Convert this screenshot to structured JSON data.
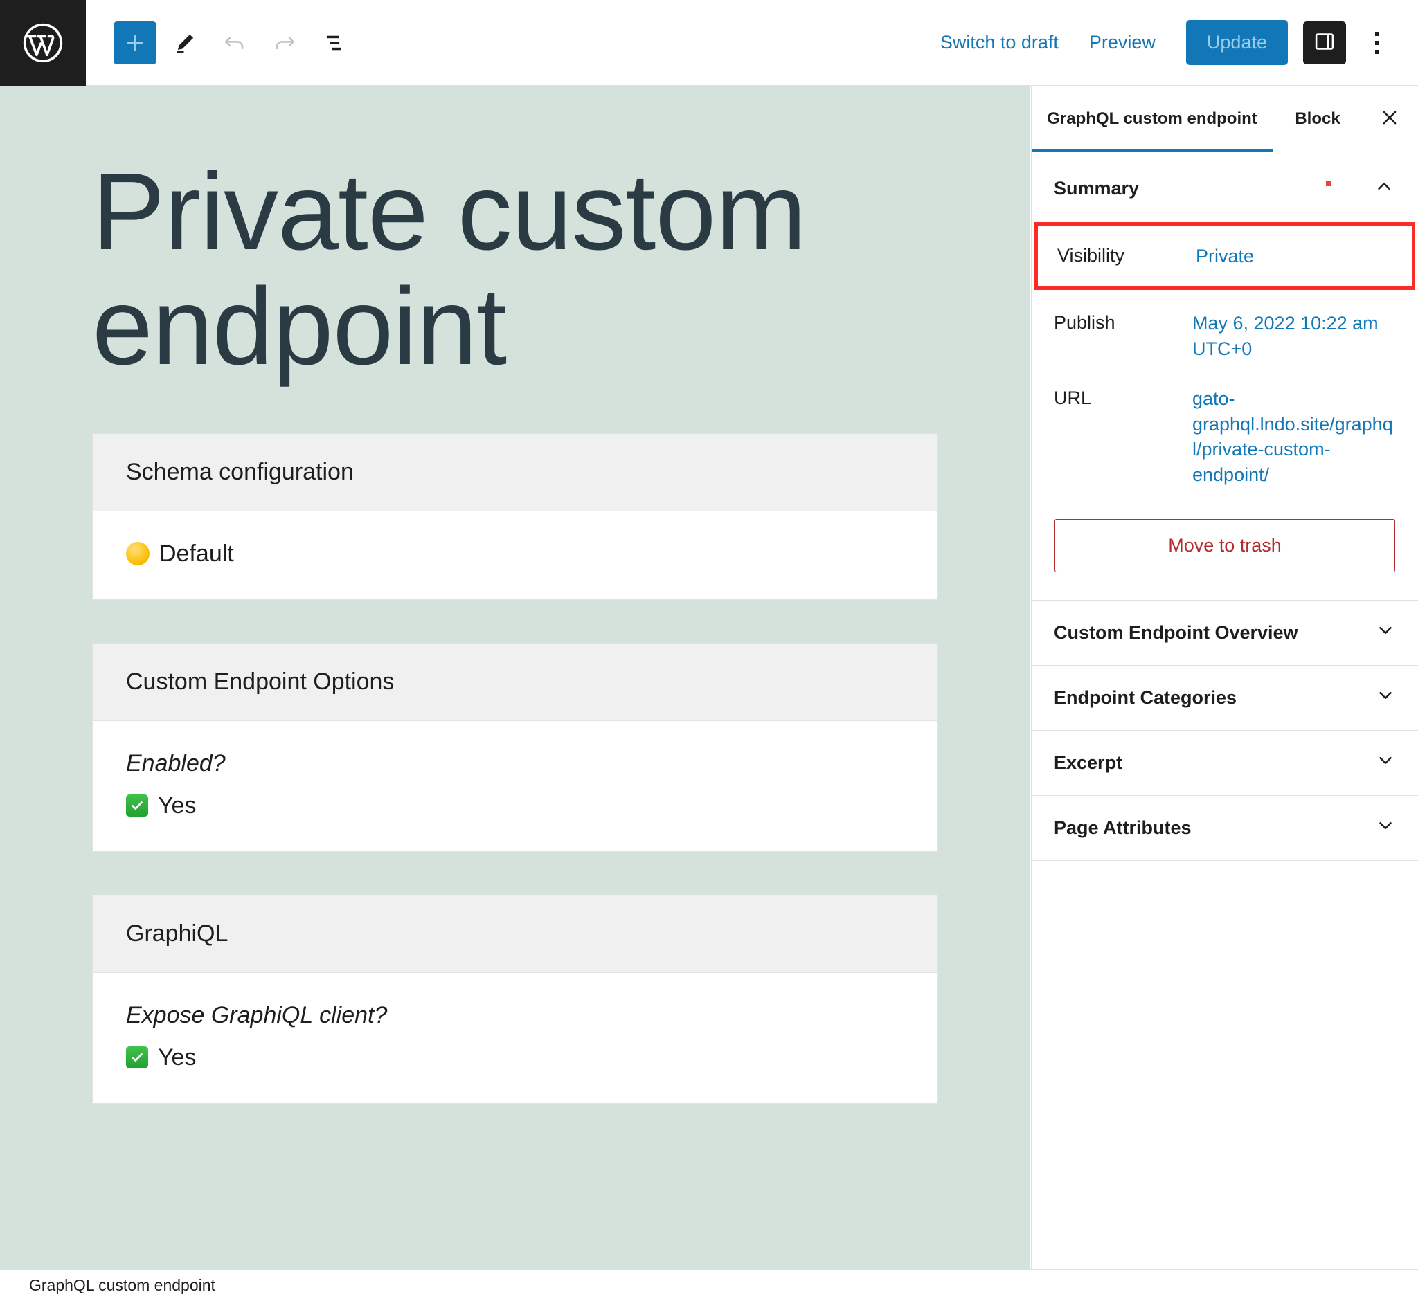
{
  "toolbar": {
    "logo_icon": "wordpress-logo-icon",
    "add_block_label": "+",
    "tools_icon": "pencil-icon",
    "undo_icon": "undo-arrow-icon",
    "redo_icon": "redo-arrow-icon",
    "list_view_icon": "list-view-icon",
    "switch_to_draft": "Switch to draft",
    "preview": "Preview",
    "update": "Update",
    "sidebar_toggle_icon": "sidebar-panel-icon",
    "options_icon": "kebab-menu-icon"
  },
  "content": {
    "post_title": "Private custom endpoint",
    "cards": [
      {
        "title": "Schema configuration",
        "label": "",
        "marker": "yellow-circle",
        "value": "Default"
      },
      {
        "title": "Custom Endpoint Options",
        "label": "Enabled?",
        "marker": "green-check",
        "value": "Yes"
      },
      {
        "title": "GraphiQL",
        "label": "Expose GraphiQL client?",
        "marker": "green-check",
        "value": "Yes"
      }
    ]
  },
  "sidebar": {
    "tab_document": "GraphQL custom endpoint",
    "tab_block": "Block",
    "close_icon": "close-icon",
    "summary": {
      "heading": "Summary",
      "collapse_icon": "chevron-up-icon",
      "rows": [
        {
          "key": "Visibility",
          "value": "Private",
          "highlighted": true
        },
        {
          "key": "Publish",
          "value": "May 6, 2022 10:22 am UTC+0",
          "highlighted": false
        },
        {
          "key": "URL",
          "value": "gato-graphql.lndo.site/graphql/private-custom-endpoint/",
          "highlighted": false
        }
      ],
      "trash_label": "Move to trash"
    },
    "panels": [
      {
        "label": "Custom Endpoint Overview",
        "icon": "chevron-down-icon"
      },
      {
        "label": "Endpoint Categories",
        "icon": "chevron-down-icon"
      },
      {
        "label": "Excerpt",
        "icon": "chevron-down-icon"
      },
      {
        "label": "Page Attributes",
        "icon": "chevron-down-icon"
      }
    ]
  },
  "statusbar": {
    "label": "GraphQL custom endpoint"
  },
  "colors": {
    "accent_blue": "#1277b6",
    "content_bg": "#d5e2dc",
    "danger_red": "#b32d2e",
    "highlight_red": "#fb2b26",
    "dark": "#1e1e1e"
  }
}
